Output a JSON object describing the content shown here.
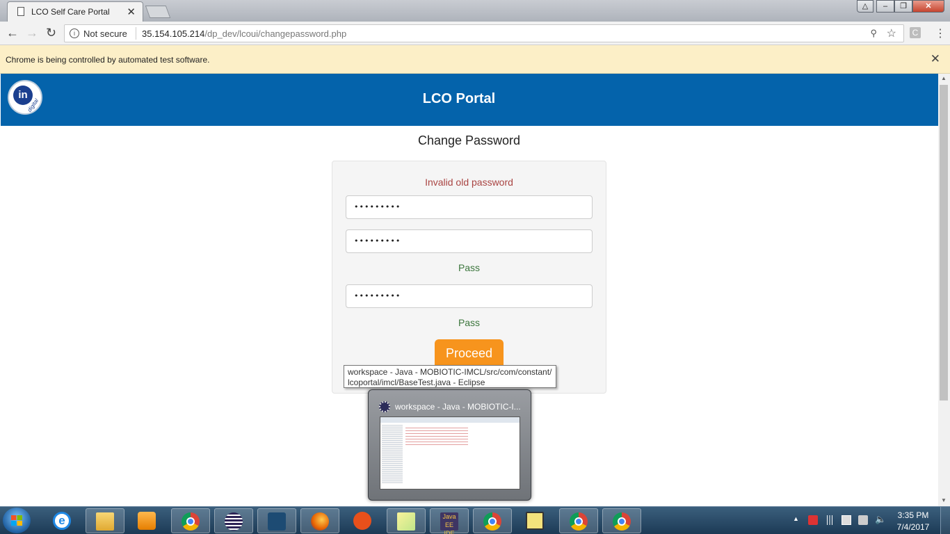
{
  "browser": {
    "tab_title": "LCO Self Care Portal",
    "tab_close": "✕",
    "not_secure": "Not secure",
    "url_host": "35.154.105.214",
    "url_path": "/dp_dev/lcoui/changepassword.php",
    "extension_label": "C",
    "infobar_text": "Chrome is being controlled by automated test software.",
    "infobar_close": "✕"
  },
  "header": {
    "logo_text": "in",
    "logo_sub": "digital",
    "title": "LCO Portal"
  },
  "main": {
    "heading": "Change Password",
    "error": "Invalid old password",
    "old_password_value": "•••••••••",
    "new_password_value": "•••••••••",
    "new_password_status": "Pass",
    "confirm_password_value": "•••••••••",
    "confirm_password_status": "Pass",
    "proceed_label": "Proceed"
  },
  "tooltip": {
    "line1": "workspace - Java - MOBIOTIC-IMCL/src/com/constant/",
    "line2": "lcoportal/imcl/BaseTest.java - Eclipse"
  },
  "preview": {
    "title": "workspace - Java - MOBIOTIC-I..."
  },
  "taskbar": {
    "apps": [
      {
        "name": "internet-explorer",
        "icon": "ie-icon"
      },
      {
        "name": "file-explorer",
        "icon": "folder-icon"
      },
      {
        "name": "media-player",
        "icon": "media-icon"
      },
      {
        "name": "chrome",
        "icon": "chrome-icon"
      },
      {
        "name": "eclipse",
        "icon": "eclipse-icon"
      },
      {
        "name": "mysql-workbench",
        "icon": "mysql-icon"
      },
      {
        "name": "firefox",
        "icon": "firefox-icon"
      },
      {
        "name": "tool",
        "icon": "tool-icon"
      },
      {
        "name": "sticky-notes",
        "icon": "notes-icon"
      },
      {
        "name": "eclipse-javaee",
        "icon": "javaee-icon"
      },
      {
        "name": "chrome",
        "icon": "chrome-icon"
      },
      {
        "name": "installer",
        "icon": "installer-icon"
      },
      {
        "name": "chrome",
        "icon": "chrome-icon"
      },
      {
        "name": "chrome",
        "icon": "chrome-icon"
      }
    ],
    "javaee_label": "Java EE IDE",
    "clock_time": "3:35 PM",
    "clock_date": "7/4/2017"
  }
}
